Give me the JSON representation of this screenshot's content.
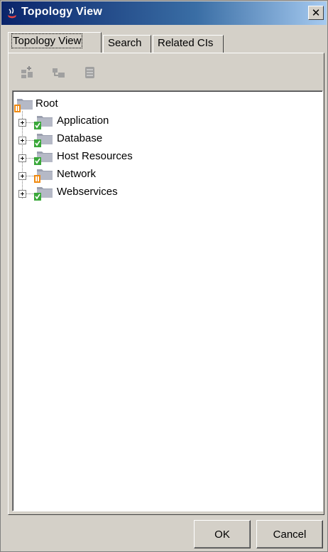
{
  "window": {
    "title": "Topology View",
    "close_glyph": "✕"
  },
  "tabs": [
    {
      "label": "Topology View",
      "active": true
    },
    {
      "label": "Search",
      "active": false
    },
    {
      "label": "Related CIs",
      "active": false
    }
  ],
  "toolbar": {
    "icons": [
      "add-to-view-icon",
      "expand-view-icon",
      "database-icon"
    ],
    "enabled": false
  },
  "tree": {
    "root": {
      "label": "Root",
      "status": "warning"
    },
    "children": [
      {
        "label": "Application",
        "status": "ok"
      },
      {
        "label": "Database",
        "status": "ok"
      },
      {
        "label": "Host Resources",
        "status": "ok"
      },
      {
        "label": "Network",
        "status": "warning"
      },
      {
        "label": "Webservices",
        "status": "ok"
      }
    ]
  },
  "buttons": {
    "ok_label": "OK",
    "cancel_label": "Cancel"
  },
  "colors": {
    "status_ok": "#3aa83a",
    "status_warning": "#f08a10",
    "folder": "#9a9fae",
    "titlebar": "#0a246a"
  }
}
